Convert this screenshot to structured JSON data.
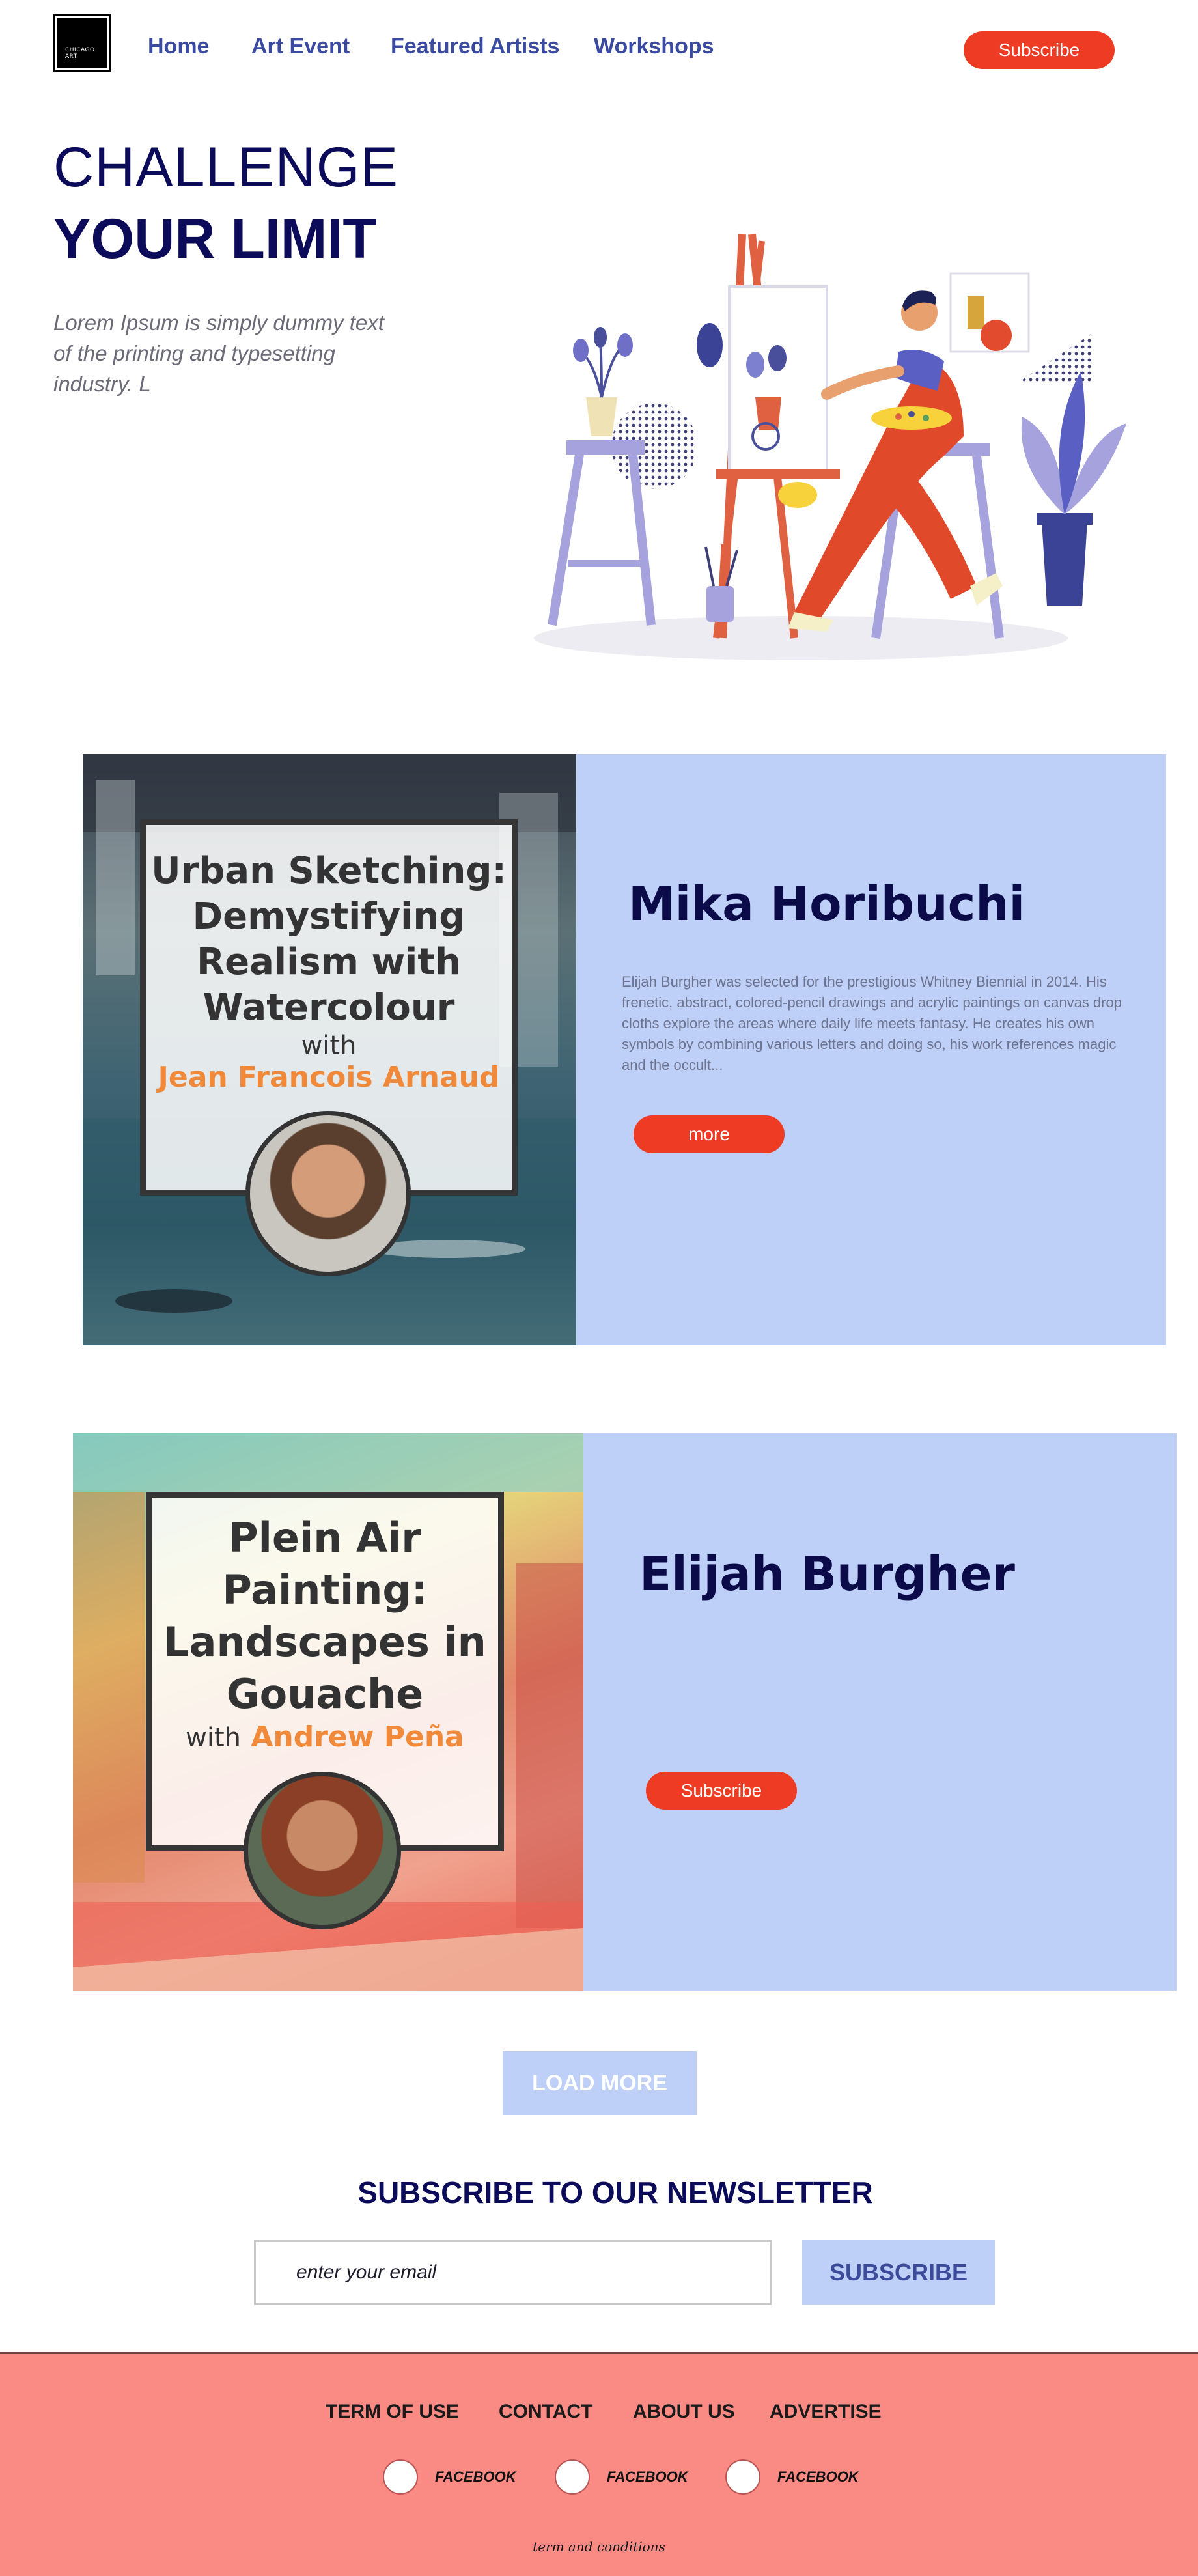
{
  "nav": {
    "logo_text": "CHICAGO ART",
    "links": [
      "Home",
      "Art Event",
      "Featured Artists",
      "Workshops"
    ],
    "subscribe_label": "Subscribe"
  },
  "hero": {
    "line1": "CHALLENGE",
    "line2": "YOUR LIMIT",
    "text": "Lorem Ipsum is simply dummy text of the printing and typesetting industry. L"
  },
  "cards": [
    {
      "poster_title": "Urban Sketching: Demystifying Realism with Watercolour",
      "poster_with": "with",
      "poster_name": "Jean Francois Arnaud",
      "artist_name": "Mika Horibuchi",
      "description": "Elijah Burgher was selected for the prestigious Whitney Biennial in 2014. His frenetic, abstract, colored-pencil drawings and acrylic paintings on canvas drop cloths explore the areas where daily life meets fantasy. He creates his own symbols by combining various letters and doing so, his work references magic and the occult...",
      "button_label": "more"
    },
    {
      "poster_title": "Plein Air Painting: Landscapes in Gouache",
      "poster_with": "with",
      "poster_name": "Andrew Peña",
      "artist_name": "Elijah Burgher",
      "button_label": "Subscribe"
    }
  ],
  "load_more_label": "LOAD MORE",
  "newsletter": {
    "title": "SUBSCRIBE TO OUR NEWSLETTER",
    "placeholder": "enter your email",
    "button_label": "SUBSCRIBE"
  },
  "footer": {
    "links": [
      "TERM OF USE",
      "CONTACT",
      "ABOUT US",
      "ADVERTISE"
    ],
    "social": [
      "FACEBOOK",
      "FACEBOOK",
      "FACEBOOK"
    ],
    "terms": "term and conditions"
  },
  "colors": {
    "accent_red": "#ee3b24",
    "panel_blue": "#bed0f7",
    "navy": "#0b0b5a",
    "footer_pink": "#f98b84",
    "orange": "#f08a3a"
  }
}
